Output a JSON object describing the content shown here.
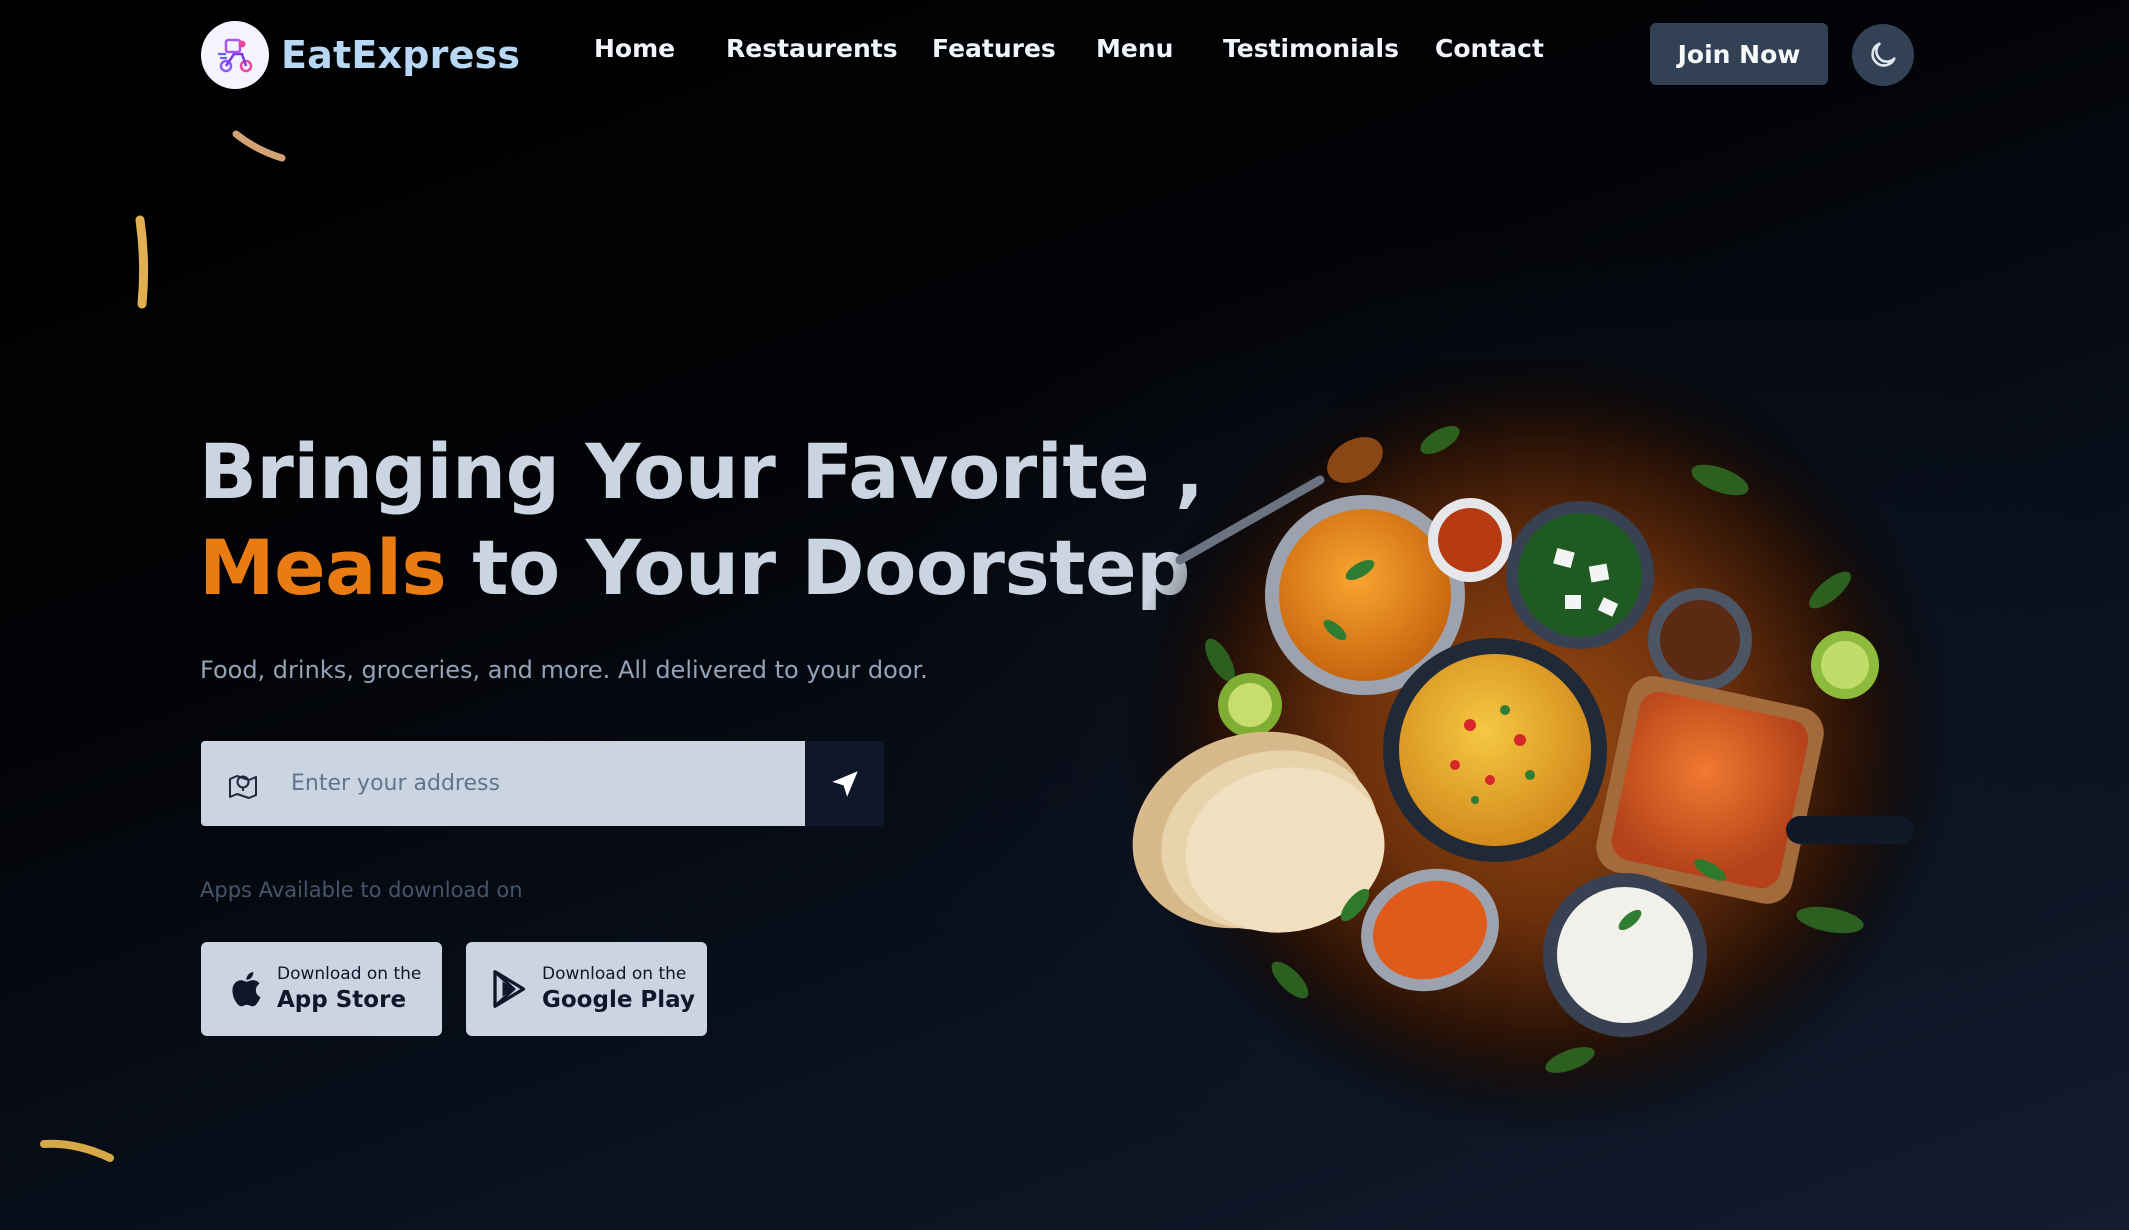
{
  "brand": {
    "name": "EatExpress",
    "logo_icon": "delivery-scooter-icon"
  },
  "nav": {
    "links": [
      {
        "label": "Home"
      },
      {
        "label": "Restaurents"
      },
      {
        "label": "Features"
      },
      {
        "label": "Menu"
      },
      {
        "label": "Testimonials"
      },
      {
        "label": "Contact"
      }
    ],
    "join_label": "Join Now",
    "theme_icon": "moon-icon"
  },
  "hero": {
    "title_line1": "Bringing Your Favorite ,",
    "title_accent": "Meals",
    "title_line2_rest": " to Your Doorstep",
    "subtitle": "Food, drinks, groceries, and more. All delivered to your door.",
    "address_placeholder": "Enter your address",
    "apps_label": "Apps Available to download on",
    "stores": [
      {
        "small": "Download on the",
        "big": "App Store",
        "icon": "apple-icon"
      },
      {
        "small": "Download on the",
        "big": "Google Play",
        "icon": "google-play-icon"
      }
    ]
  },
  "colors": {
    "accent": "#ea7b12",
    "brand_text": "#b8d7f5",
    "button_bg": "#334155",
    "input_bg": "#cbd5e1"
  }
}
